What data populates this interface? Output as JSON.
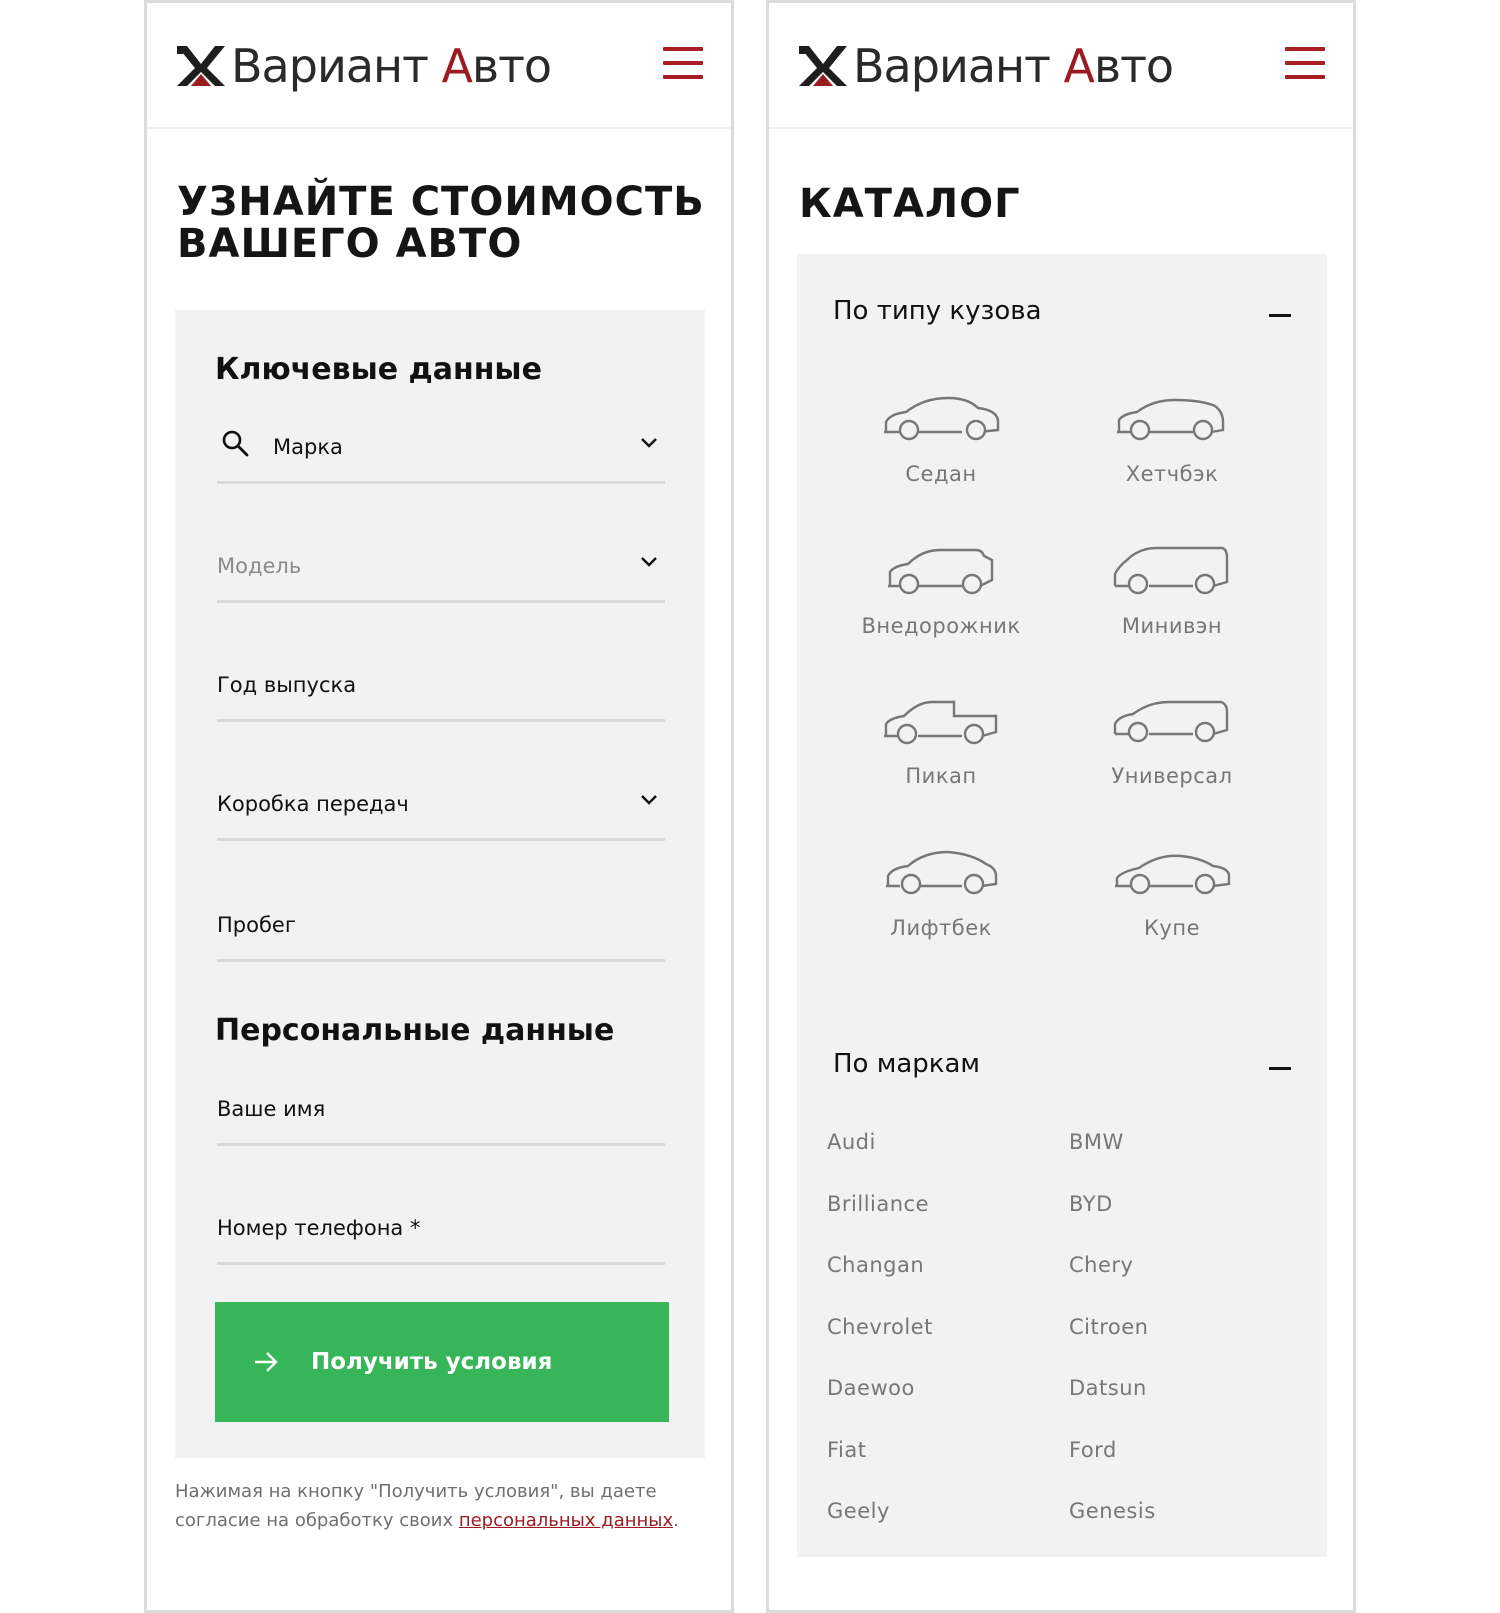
{
  "brand": {
    "logo_main": "Вариант ",
    "logo_accent": "А",
    "logo_rest": "вто"
  },
  "colors": {
    "accent": "#a61d24",
    "button": "#37b559",
    "panel": "#f2f2f2",
    "muted": "#777777"
  },
  "left": {
    "title_line1": "УЗНАЙТЕ СТОИМОСТЬ",
    "title_line2": "ВАШЕГО АВТО",
    "key_section": "Ключевые данные",
    "fields": {
      "brand": "Марка",
      "model": "Модель",
      "year": "Год выпуска",
      "gearbox": "Коробка передач",
      "mileage": "Пробег"
    },
    "personal_section": "Персональные данные",
    "personal": {
      "name": "Ваше имя",
      "phone": "Номер телефона *"
    },
    "submit": "Получить условия",
    "consent_text": "Нажимая на кнопку \"Получить условия\", вы даете согласие на обработку своих ",
    "consent_link": "персональных данных",
    "consent_end": "."
  },
  "right": {
    "title": "КАТАЛОГ",
    "body_section": "По типу кузова",
    "body_types": [
      "Седан",
      "Хетчбэк",
      "Внедорожник",
      "Минивэн",
      "Пикап",
      "Универсал",
      "Лифтбек",
      "Купе"
    ],
    "brands_section": "По маркам",
    "brands": [
      "Audi",
      "BMW",
      "Brilliance",
      "BYD",
      "Changan",
      "Chery",
      "Chevrolet",
      "Citroen",
      "Daewoo",
      "Datsun",
      "Fiat",
      "Ford",
      "Geely",
      "Genesis"
    ]
  },
  "icons": {
    "logo": "logo-mark-icon",
    "menu": "hamburger-menu-icon",
    "search": "search-icon",
    "chevron": "chevron-down-icon",
    "arrow": "arrow-right-icon",
    "collapse": "minus-icon"
  }
}
